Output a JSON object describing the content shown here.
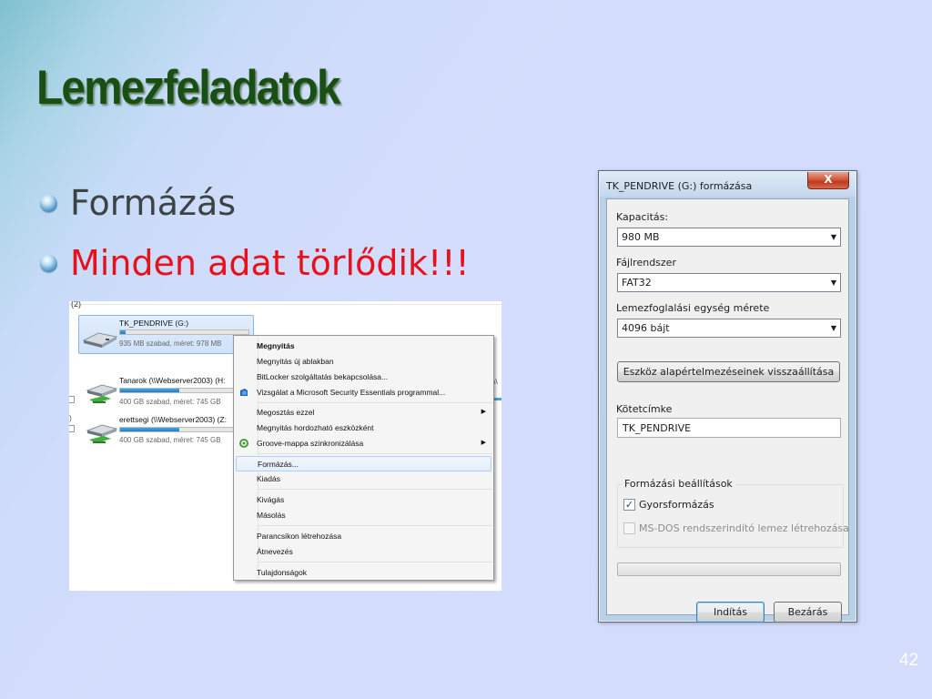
{
  "slide": {
    "title": "Lemezfeladatok",
    "bullets": [
      {
        "text": "Formázás",
        "color": "#3d4343"
      },
      {
        "text": "Minden adat törlődik!!!",
        "color": "#e8111b"
      }
    ],
    "page_number": "42"
  },
  "explorer": {
    "group_label": "(2)",
    "drive": {
      "name": "TK_PENDRIVE (G:)",
      "free": "935 MB szabad, méret: 978 MB",
      "used_fraction": 0.04
    },
    "network": [
      {
        "name": "Tanarok (\\\\Webserver2003) (H:",
        "free": "400 GB szabad, méret: 745 GB",
        "used_fraction": 0.46
      },
      {
        "name": "erettsegi (\\\\Webserver2003) (Z:",
        "free": "400 GB szabad, méret: 745 GB",
        "used_fraction": 0.46
      }
    ],
    "cut_fragments": {
      "row1_right": "\\\\",
      "row1_left": "",
      "row2_left": ")"
    }
  },
  "context_menu": {
    "items": {
      "open": "Megnyitás",
      "open_new_window": "Megnyitás új ablakban",
      "bitlocker": "BitLocker szolgáltatás bekapcsolása...",
      "mse_scan": "Vizsgálat a Microsoft Security Essentials programmal...",
      "share": "Megosztás ezzel",
      "open_portable": "Megnyitás hordozható eszközként",
      "groove": "Groove-mappa szinkronizálása",
      "format": "Formázás...",
      "eject": "Kiadás",
      "cut": "Kivágás",
      "copy": "Másolás",
      "create_shortcut": "Parancsikon létrehozása",
      "rename": "Átnevezés",
      "properties": "Tulajdonságok"
    },
    "submenu_arrow": "▶"
  },
  "format_dialog": {
    "title": "TK_PENDRIVE (G:) formázása",
    "close_glyph": "X",
    "capacity": {
      "label": "Kapacitás:",
      "value": "980 MB"
    },
    "filesystem": {
      "label": "Fájlrendszer",
      "value": "FAT32"
    },
    "allocation": {
      "label": "Lemezfoglalási egység mérete",
      "value": "4096 bájt"
    },
    "restore_defaults": "Eszköz alapértelmezéseinek visszaállítása",
    "volume_label": {
      "label": "Kötetcímke",
      "value": "TK_PENDRIVE"
    },
    "options": {
      "legend": "Formázási beállítások",
      "quick_format": {
        "label": "Gyorsformázás",
        "checked": true,
        "mark": "✓"
      },
      "msdos_boot": {
        "label": "MS-DOS rendszerindító lemez létrehozása",
        "checked": false
      }
    },
    "progress": 0,
    "start_button": "Indítás",
    "close_button": "Bezárás",
    "combo_arrow": "▼"
  }
}
